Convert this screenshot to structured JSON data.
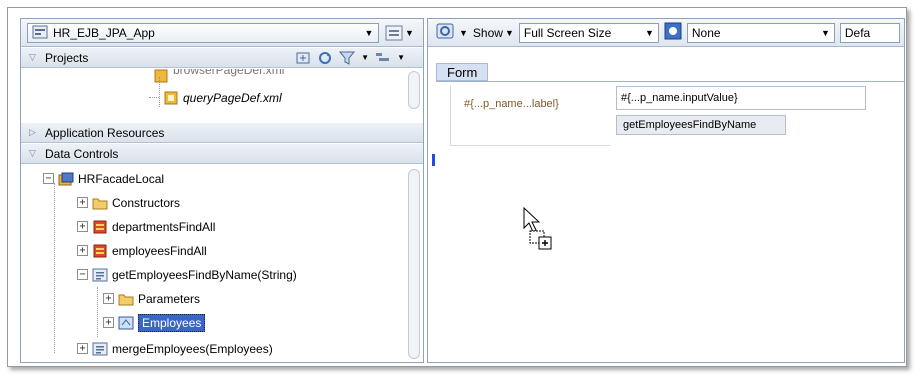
{
  "app_selector": {
    "value": "HR_EJB_JPA_App"
  },
  "projects": {
    "header": "Projects",
    "partial_file": "browserPageDef.xml",
    "file": "queryPageDef.xml"
  },
  "application_resources": {
    "header": "Application Resources"
  },
  "data_controls": {
    "header": "Data Controls",
    "root": "HRFacadeLocal",
    "items": [
      {
        "label": "Constructors"
      },
      {
        "label": "departmentsFindAll"
      },
      {
        "label": "employeesFindAll"
      },
      {
        "label": "getEmployeesFindByName(String)"
      },
      {
        "label": "Parameters"
      },
      {
        "label": "Employees"
      },
      {
        "label": "mergeEmployees(Employees)"
      }
    ]
  },
  "toolbar": {
    "show_label": "Show",
    "size_value": "Full Screen Size",
    "skin_value": "None",
    "default_partial": "Defa"
  },
  "form": {
    "tab_label": "Form",
    "field_label": "#{...p_name...label}",
    "field_value": "#{...p_name.inputValue}",
    "button_label": "getEmployeesFindByName"
  },
  "colors": {
    "selection": "#3a66c4",
    "pane_border": "#8fa3bd",
    "caret": "#1f4fd8"
  },
  "icons": [
    "application-icon",
    "filter-icon",
    "folder-icon",
    "page-def-icon",
    "collection-icon",
    "method-icon",
    "data-control-icon",
    "drag-cursor-icon",
    "copy-plus-icon"
  ]
}
